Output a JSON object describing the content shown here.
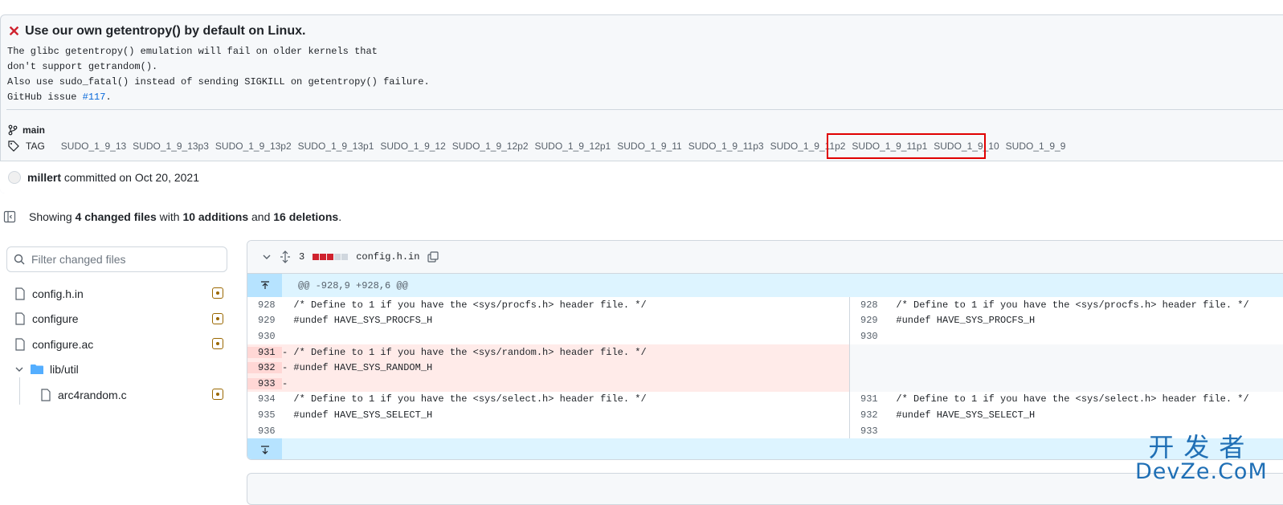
{
  "commit": {
    "title": "Use our own getentropy() by default on Linux.",
    "desc_lines": [
      "The glibc getentropy() emulation will fail on older kernels that",
      "don't support getrandom().",
      "Also use sudo_fatal() instead of sending SIGKILL on getentropy() failure."
    ],
    "issue_prefix": "GitHub issue ",
    "issue_link": "#117",
    "issue_suffix": ".",
    "branch": "main",
    "tag_label": "TAG",
    "tags": [
      "SUDO_1_9_13",
      "SUDO_1_9_13p3",
      "SUDO_1_9_13p2",
      "SUDO_1_9_13p1",
      "SUDO_1_9_12",
      "SUDO_1_9_12p2",
      "SUDO_1_9_12p1",
      "SUDO_1_9_11",
      "SUDO_1_9_11p3",
      "SUDO_1_9_11p2",
      "SUDO_1_9_11p1",
      "SUDO_1_9_10",
      "SUDO_1_9_9"
    ],
    "author": "millert",
    "committed_text": "committed on Oct 20, 2021"
  },
  "summary": {
    "showing": "Showing",
    "changed": "4 changed files",
    "with": "with",
    "additions": "10 additions",
    "and": "and",
    "deletions": "16 deletions",
    "period": "."
  },
  "file_tree": {
    "filter_placeholder": "Filter changed files",
    "items": [
      {
        "label": "config.h.in",
        "type": "file"
      },
      {
        "label": "configure",
        "type": "file"
      },
      {
        "label": "configure.ac",
        "type": "file"
      },
      {
        "label": "lib/util",
        "type": "folder"
      },
      {
        "label": "arc4random.c",
        "type": "file"
      }
    ]
  },
  "diff": {
    "change_count": "3",
    "filename": "config.h.in",
    "hunk_header": "@@ -928,9 +928,6 @@",
    "left_lines": [
      {
        "num": "928",
        "code": "  /* Define to 1 if you have the <sys/procfs.h> header file. */",
        "type": "ctx"
      },
      {
        "num": "929",
        "code": "  #undef HAVE_SYS_PROCFS_H",
        "type": "ctx"
      },
      {
        "num": "930",
        "code": "",
        "type": "ctx"
      },
      {
        "num": "931",
        "code": "- /* Define to 1 if you have the <sys/random.h> header file. */",
        "type": "del"
      },
      {
        "num": "932",
        "code": "- #undef HAVE_SYS_RANDOM_H",
        "type": "del"
      },
      {
        "num": "933",
        "code": "-",
        "type": "del"
      },
      {
        "num": "934",
        "code": "  /* Define to 1 if you have the <sys/select.h> header file. */",
        "type": "ctx"
      },
      {
        "num": "935",
        "code": "  #undef HAVE_SYS_SELECT_H",
        "type": "ctx"
      },
      {
        "num": "936",
        "code": "",
        "type": "ctx"
      }
    ],
    "right_lines": [
      {
        "num": "928",
        "code": "  /* Define to 1 if you have the <sys/procfs.h> header file. */"
      },
      {
        "num": "929",
        "code": "  #undef HAVE_SYS_PROCFS_H"
      },
      {
        "num": "930",
        "code": ""
      },
      {
        "num": "",
        "code": ""
      },
      {
        "num": "",
        "code": ""
      },
      {
        "num": "",
        "code": ""
      },
      {
        "num": "931",
        "code": "  /* Define to 1 if you have the <sys/select.h> header file. */"
      },
      {
        "num": "932",
        "code": "  #undef HAVE_SYS_SELECT_H"
      },
      {
        "num": "933",
        "code": ""
      }
    ]
  },
  "watermark": {
    "cn": "开发者",
    "en": "DevZe.CoM"
  }
}
